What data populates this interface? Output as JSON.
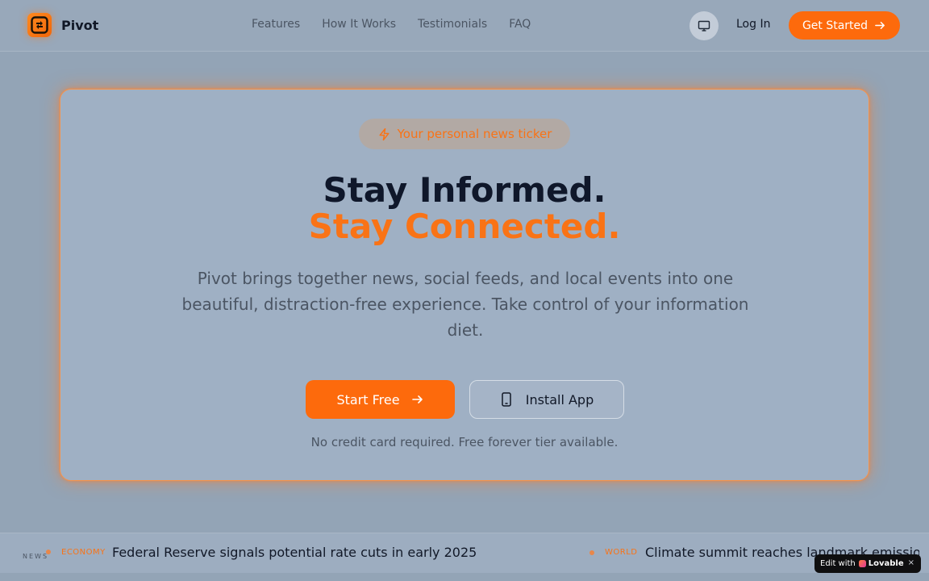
{
  "header": {
    "brand": "Pivot",
    "nav": [
      {
        "label": "Features"
      },
      {
        "label": "How It Works"
      },
      {
        "label": "Testimonials"
      },
      {
        "label": "FAQ"
      }
    ],
    "theme_icon": "monitor-icon",
    "login_label": "Log In",
    "cta_label": "Get Started"
  },
  "hero": {
    "badge": "Your personal news ticker",
    "badge_icon": "lightning-icon",
    "title_line1": "Stay Informed.",
    "title_line2": "Stay Connected.",
    "description": "Pivot brings together news, social feeds, and local events into one beautiful, distraction-free experience. Take control of your information diet.",
    "primary_cta": "Start Free",
    "secondary_cta": "Install App",
    "note": "No credit card required. Free forever tier available."
  },
  "ticker": {
    "title": "NEWS",
    "items": [
      {
        "category": "ECONOMY",
        "headline": "Federal Reserve signals potential rate cuts in early 2025"
      },
      {
        "category": "WORLD",
        "headline": "Climate summit reaches landmark emissio"
      }
    ]
  },
  "badge": {
    "prefix": "Edit with",
    "brand": "Lovable",
    "close": "×"
  },
  "colors": {
    "accent": "#f97316",
    "button": "#fd6a0c",
    "background": "#93a4b6",
    "text_dark": "#0f172a",
    "text_muted": "#4b5563"
  }
}
